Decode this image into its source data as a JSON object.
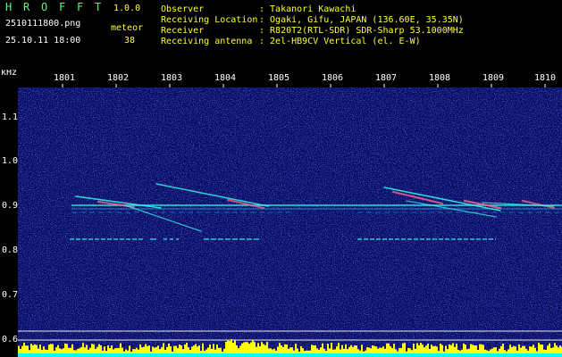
{
  "app": {
    "title_letters": [
      "H",
      "R",
      "O",
      "F",
      "F",
      "T"
    ],
    "version": "1.0.0"
  },
  "file": {
    "name": "2510111800.png",
    "datetime": "25.10.11 18:00"
  },
  "meteor": {
    "label": "meteor",
    "count": "38"
  },
  "info": {
    "rows": [
      {
        "label": "Observer",
        "value": ": Takanori Kawachi"
      },
      {
        "label": "Receiving Location",
        "value": ": Ogaki, Gifu, JAPAN (136.60E, 35.35N)"
      },
      {
        "label": "Receiver",
        "value": ": R820T2(RTL-SDR) SDR-Sharp 53.1000MHz"
      },
      {
        "label": "Receiving antenna",
        "value": ": 2el-HB9CV Vertical (el. E-W)"
      }
    ]
  },
  "axes": {
    "y_unit": "kHz",
    "x_ticks": [
      "1801",
      "1802",
      "1803",
      "1804",
      "1805",
      "1806",
      "1807",
      "1808",
      "1809",
      "1810"
    ],
    "y_ticks": [
      "1.1",
      "1.0",
      "0.9",
      "0.8",
      "0.7",
      "0.6"
    ]
  },
  "colors": {
    "background": "#000000",
    "spectrogram_bg": "#0a0a5a",
    "title_green": "#44ff77",
    "yellow_text": "#ffff33",
    "signal_cyan": "#33ffee",
    "signal_hot": "#ff6688",
    "level_yellow": "#ffff00",
    "level_cyan": "#00ffff"
  }
}
